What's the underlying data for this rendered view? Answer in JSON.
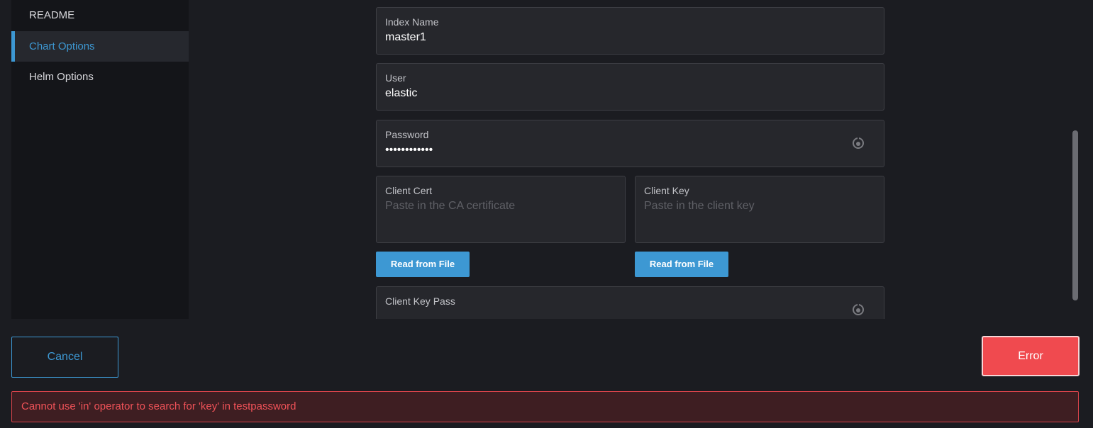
{
  "sidebar": {
    "items": [
      {
        "label": "README"
      },
      {
        "label": "Chart Options"
      },
      {
        "label": "Helm Options"
      }
    ],
    "active_index": 1
  },
  "form": {
    "index_name": {
      "label": "Index Name",
      "value": "master1"
    },
    "user": {
      "label": "User",
      "value": "elastic"
    },
    "password": {
      "label": "Password",
      "value": "testpassword",
      "icon": "eye-icon"
    },
    "client_cert": {
      "label": "Client Cert",
      "value": "",
      "placeholder": "Paste in the CA certificate"
    },
    "client_key": {
      "label": "Client Key",
      "value": "",
      "placeholder": "Paste in the client key"
    },
    "read_file_label": "Read from File",
    "client_key_pass": {
      "label": "Client Key Pass",
      "value": "",
      "icon": "eye-icon"
    }
  },
  "footer": {
    "cancel_label": "Cancel",
    "error_label": "Error",
    "error_message": "Cannot use 'in' operator to search for 'key' in testpassword"
  },
  "colors": {
    "accent": "#3d98d3",
    "error": "#f04a4f",
    "background": "#1b1c21",
    "sidebar_bg": "#141519",
    "field_bg": "#26272c"
  }
}
